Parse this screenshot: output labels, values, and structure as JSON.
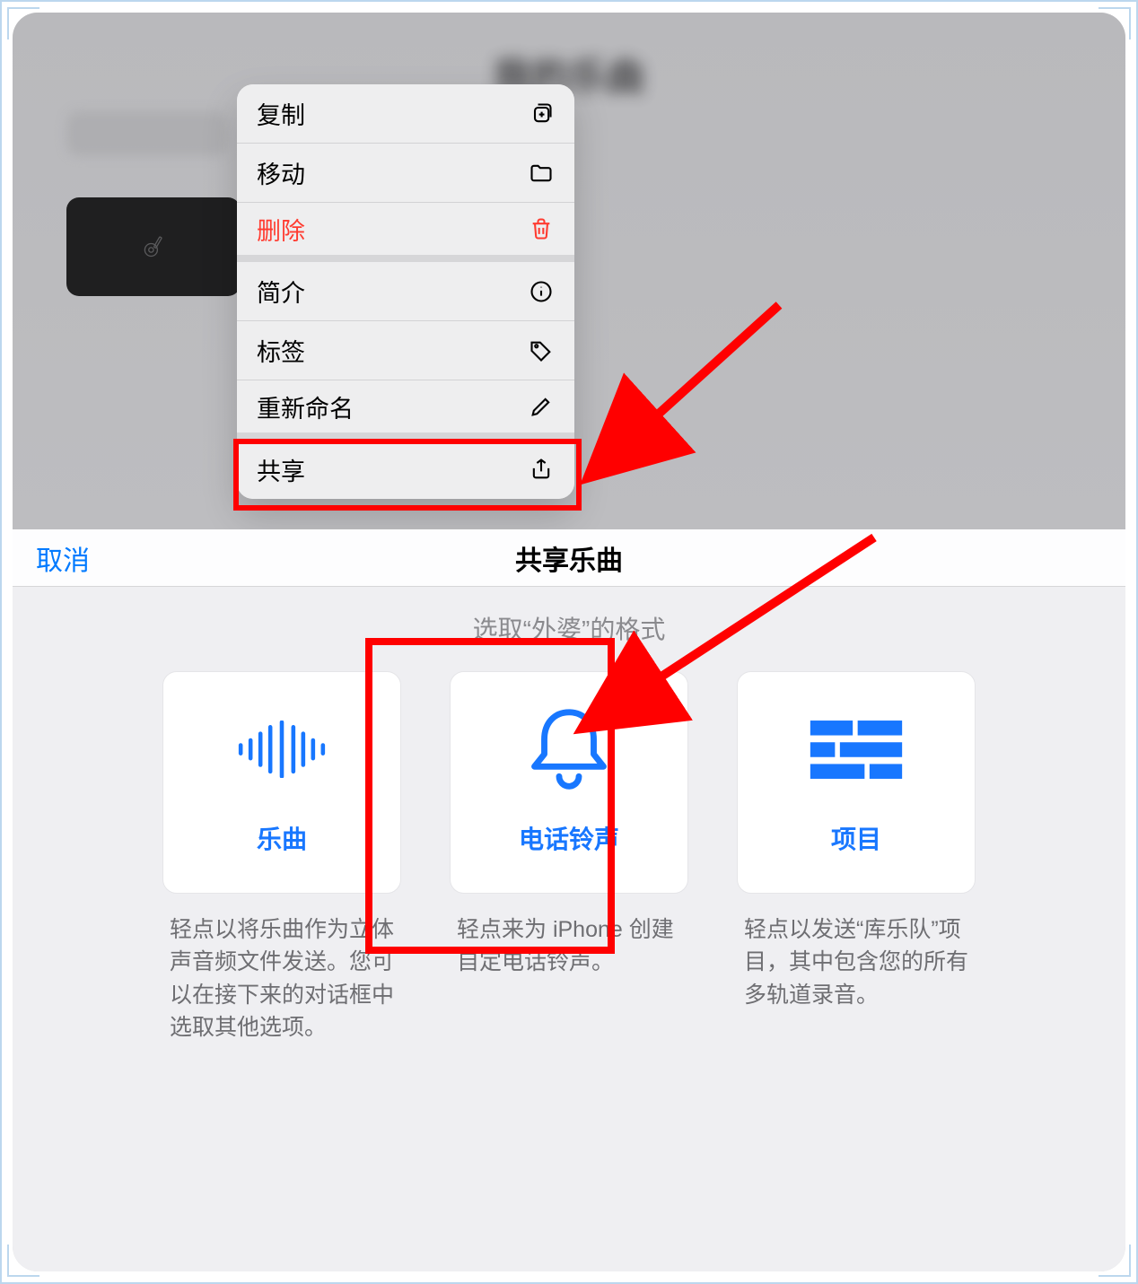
{
  "top": {
    "blurred_title": "我的乐曲",
    "menu": {
      "copy": "复制",
      "move": "移动",
      "delete": "删除",
      "info": "简介",
      "tags": "标签",
      "rename": "重新命名",
      "share": "共享"
    }
  },
  "share_sheet": {
    "cancel": "取消",
    "title": "共享乐曲",
    "subtitle": "选取“外婆”的格式",
    "cards": {
      "song": {
        "label": "乐曲",
        "desc": "轻点以将乐曲作为立体声音频文件发送。您可以在接下来的对话框中选取其他选项。"
      },
      "ringtone": {
        "label": "电话铃声",
        "desc": "轻点来为 iPhone 创建自定电话铃声。"
      },
      "project": {
        "label": "项目",
        "desc": "轻点以发送“库乐队”项目，其中包含您的所有多轨道录音。"
      }
    }
  }
}
